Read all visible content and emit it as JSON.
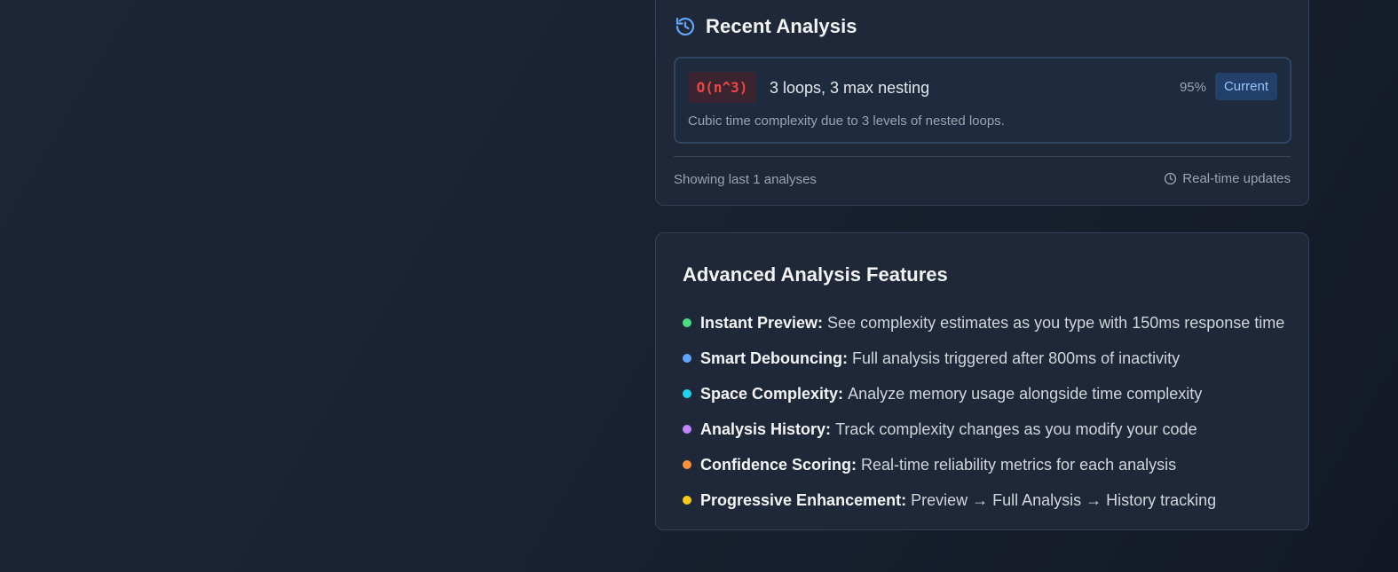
{
  "recent_analysis": {
    "title": "Recent Analysis",
    "icon": "history-icon",
    "accent_color": "#60a5fa",
    "items": [
      {
        "complexity": "O(n^3)",
        "summary": "3 loops, 3 max nesting",
        "confidence": "95%",
        "tag": "Current",
        "description": "Cubic time complexity due to 3 levels of nested loops.",
        "complexity_color": "#ef4444"
      }
    ],
    "footer": {
      "count_text": "Showing last 1 analyses",
      "updates_text": "Real-time updates",
      "updates_icon": "clock-icon"
    }
  },
  "advanced_features": {
    "title": "Advanced Analysis Features",
    "items": [
      {
        "name": "Instant Preview:",
        "description": "See complexity estimates as you type with 150ms response time",
        "dot_color": "#4ade80"
      },
      {
        "name": "Smart Debouncing:",
        "description": "Full analysis triggered after 800ms of inactivity",
        "dot_color": "#60a5fa"
      },
      {
        "name": "Space Complexity:",
        "description": "Analyze memory usage alongside time complexity",
        "dot_color": "#22d3ee"
      },
      {
        "name": "Analysis History:",
        "description": "Track complexity changes as you modify your code",
        "dot_color": "#c084fc"
      },
      {
        "name": "Confidence Scoring:",
        "description": "Real-time reliability metrics for each analysis",
        "dot_color": "#fb923c"
      },
      {
        "name": "Progressive Enhancement:",
        "description": "Preview → Full Analysis → History tracking",
        "dot_color": "#facc15"
      }
    ]
  }
}
